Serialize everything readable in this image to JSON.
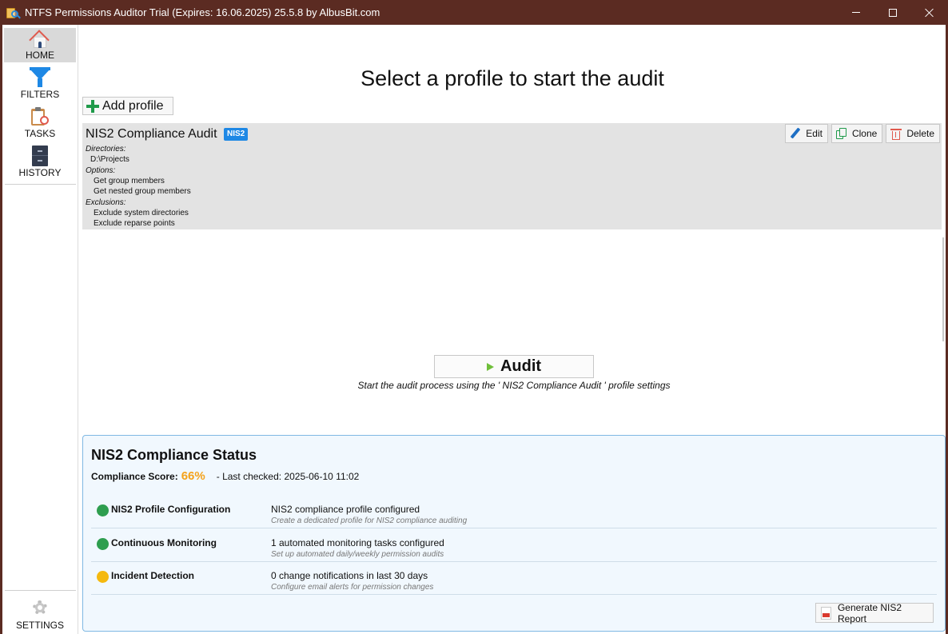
{
  "window": {
    "title": "NTFS Permissions Auditor Trial (Expires: 16.06.2025) 25.5.8 by AlbusBit.com"
  },
  "sidebar": {
    "items": [
      {
        "label": "HOME",
        "icon": "home-icon"
      },
      {
        "label": "FILTERS",
        "icon": "filter-icon"
      },
      {
        "label": "TASKS",
        "icon": "tasks-icon"
      },
      {
        "label": "HISTORY",
        "icon": "history-icon"
      }
    ],
    "settings_label": "SETTINGS"
  },
  "main": {
    "title": "Select a profile to start the audit",
    "add_profile_label": "Add profile"
  },
  "profile": {
    "name": "NIS2 Compliance Audit",
    "badge": "NIS2",
    "directories_label": "Directories:",
    "directories": [
      "D:\\Projects"
    ],
    "options_label": "Options:",
    "options": [
      "Get group members",
      "Get nested group members"
    ],
    "exclusions_label": "Exclusions:",
    "exclusions": [
      "Exclude system directories",
      "Exclude reparse points"
    ],
    "edit_label": "Edit",
    "clone_label": "Clone",
    "delete_label": "Delete"
  },
  "audit": {
    "button_label": "Audit",
    "hint": "Start the audit process using the ' NIS2 Compliance Audit ' profile settings"
  },
  "compliance": {
    "title": "NIS2 Compliance Status",
    "score_label": "Compliance Score:",
    "score_value": "66%",
    "last_checked": "- Last checked: 2025-06-10 11:02",
    "colors": {
      "ok": "#2e9e4f",
      "warning": "#f5b90f",
      "score": "#f4a21a"
    },
    "rows": [
      {
        "name": "NIS2 Profile Configuration",
        "status": "ok",
        "value": "NIS2 compliance profile configured",
        "hint": "Create a dedicated profile for NIS2 compliance auditing"
      },
      {
        "name": "Continuous Monitoring",
        "status": "ok",
        "value": "1 automated monitoring tasks configured",
        "hint": "Set up automated daily/weekly permission audits"
      },
      {
        "name": "Incident Detection",
        "status": "warning",
        "value": "0 change notifications in last 30 days",
        "hint": "Configure email alerts for permission changes"
      }
    ],
    "report_button_label": "Generate NIS2 Report"
  }
}
